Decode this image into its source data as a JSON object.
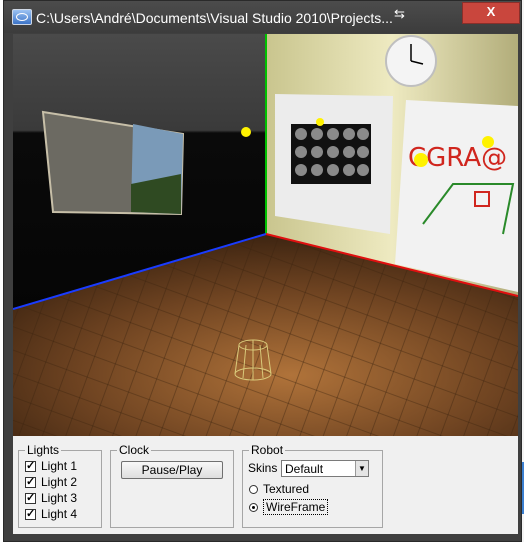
{
  "window": {
    "title": "C:\\Users\\André\\Documents\\Visual Studio 2010\\Projects...",
    "close_label": "X",
    "minimize_label": "–"
  },
  "panel": {
    "lights": {
      "title": "Lights",
      "items": [
        {
          "label": "Light 1",
          "checked": true
        },
        {
          "label": "Light 2",
          "checked": true
        },
        {
          "label": "Light 3",
          "checked": true
        },
        {
          "label": "Light 4",
          "checked": true
        }
      ]
    },
    "clock": {
      "title": "Clock",
      "button_label": "Pause/Play"
    },
    "robot": {
      "title": "Robot",
      "skins_label": "Skins",
      "skins_value": "Default",
      "options": [
        {
          "label": "Textured",
          "selected": false
        },
        {
          "label": "WireFrame",
          "selected": true
        }
      ]
    }
  },
  "scene": {
    "poster_text": "CGRA@",
    "colors": {
      "floor": "#6b3f1d",
      "wall_right": "#e6e0b0",
      "wall_left": "#2b2b2b",
      "light": "#fff200"
    }
  }
}
